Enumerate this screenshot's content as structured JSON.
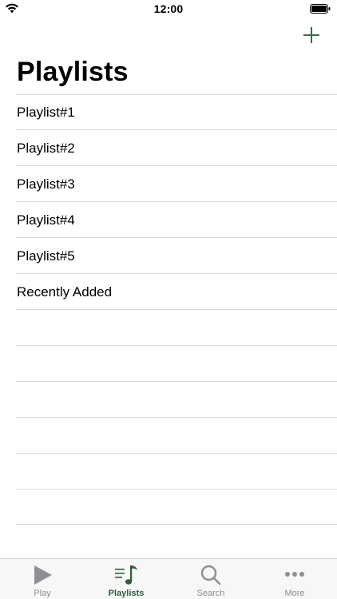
{
  "status_bar": {
    "time": "12:00",
    "wifi_icon": "wifi-icon",
    "battery_icon": "battery-icon"
  },
  "nav": {
    "add_icon": "plus-icon",
    "accent": "#3f6b48"
  },
  "page": {
    "title": "Playlists"
  },
  "playlists": [
    {
      "label": "Playlist#1"
    },
    {
      "label": "Playlist#2"
    },
    {
      "label": "Playlist#3"
    },
    {
      "label": "Playlist#4"
    },
    {
      "label": "Playlist#5"
    },
    {
      "label": "Recently Added"
    }
  ],
  "tab_bar": {
    "tabs": [
      {
        "label": "Play",
        "icon": "play-icon",
        "active": false
      },
      {
        "label": "Playlists",
        "icon": "playlists-icon",
        "active": true
      },
      {
        "label": "Search",
        "icon": "search-icon",
        "active": false
      },
      {
        "label": "More",
        "icon": "more-icon",
        "active": false
      }
    ],
    "active_color": "#2f5f3a",
    "inactive_color": "#8e8e93"
  }
}
